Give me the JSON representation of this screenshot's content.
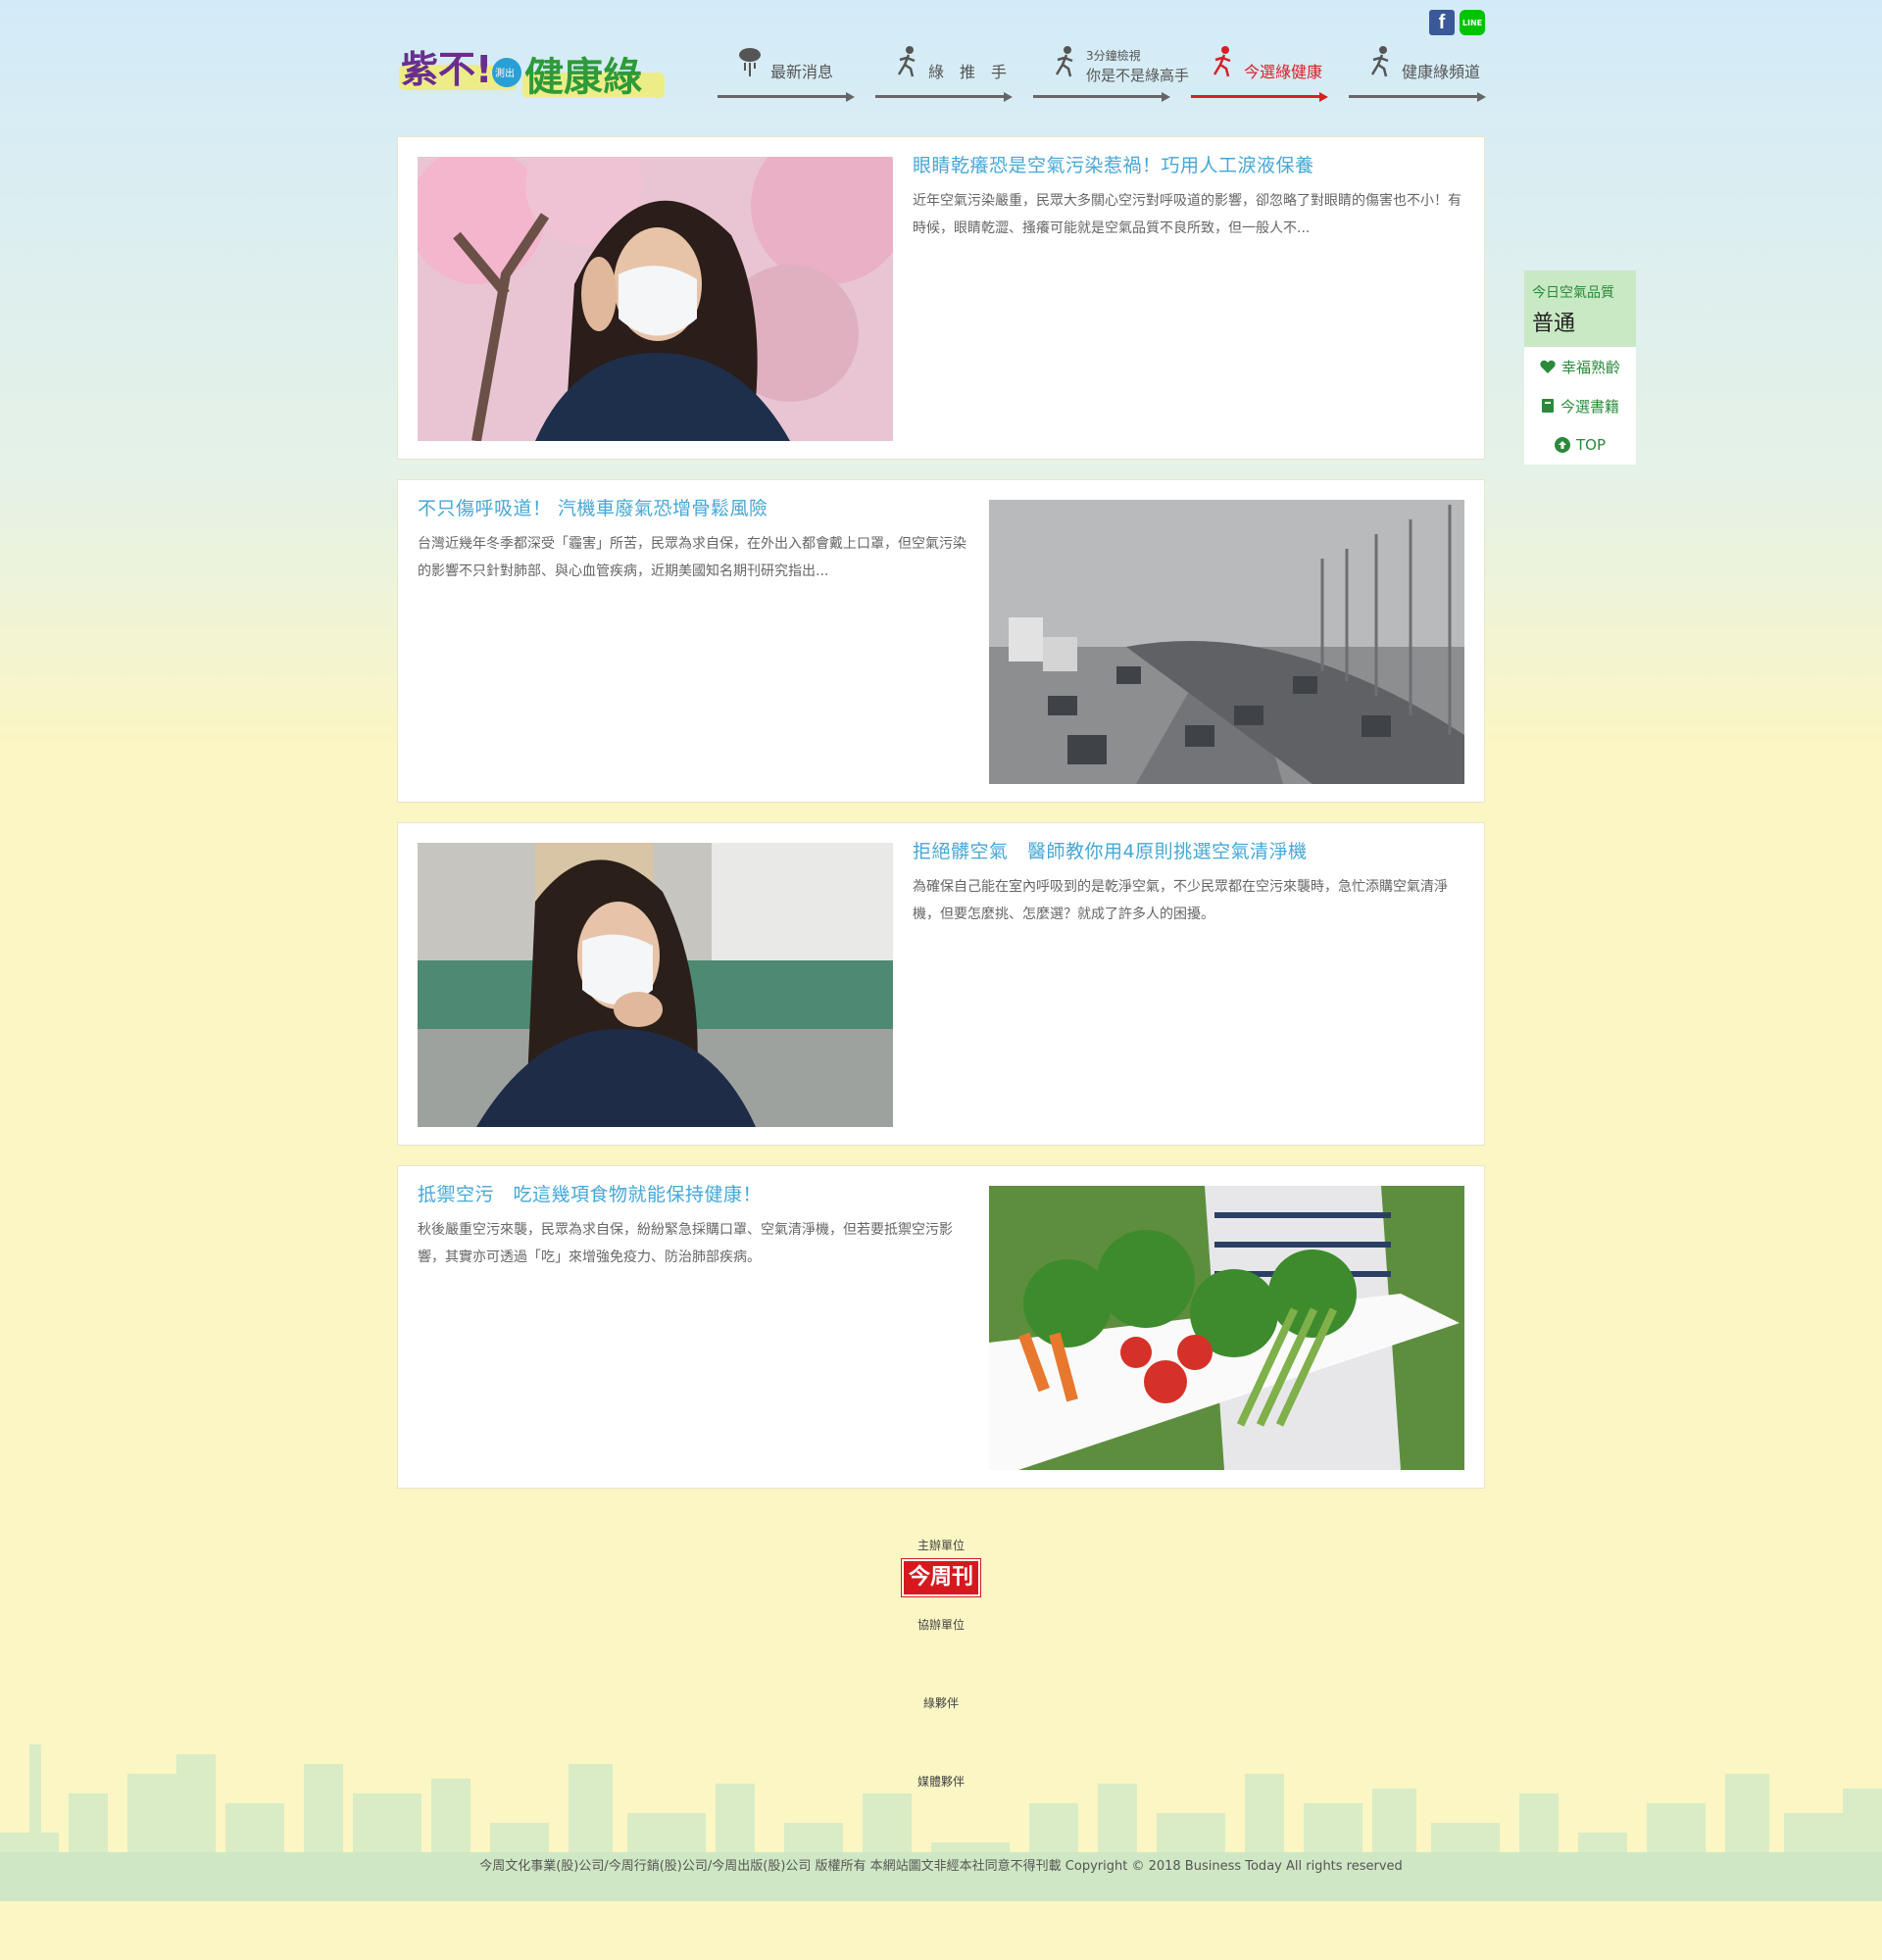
{
  "header": {
    "logo_title": "紫不!",
    "logo_small": "測出",
    "logo_main": "健康綠",
    "social": {
      "facebook_icon": "facebook-icon",
      "line_label": "LINE"
    },
    "nav": [
      {
        "label": "最新消息",
        "icon": "cloud-rain-icon"
      },
      {
        "label": "綠　推　手",
        "icon": "runner-icon"
      },
      {
        "small": "3分鐘檢視",
        "label": "你是不是綠高手",
        "icon": "runner-icon"
      },
      {
        "label": "今選綠健康",
        "icon": "runner-red-icon",
        "active": true
      },
      {
        "label": "健康綠頻道",
        "icon": "runner-icon"
      }
    ]
  },
  "articles": [
    {
      "title": "眼睛乾癢恐是空氣污染惹禍！巧用人工淚液保養",
      "excerpt": "近年空氣污染嚴重，民眾大多關心空污對呼吸道的影響，卻忽略了對眼睛的傷害也不小！有時候，眼睛乾澀、搔癢可能就是空氣品質不良所致，但一般人不...",
      "image": "woman-mask-cherry-blossom"
    },
    {
      "title": "不只傷呼吸道！ 汽機車廢氣恐增骨鬆風險",
      "excerpt": "台灣近幾年冬季都深受「霾害」所苦，民眾為求自保，在外出入都會戴上口罩，但空氣污染的影響不只針對肺部、與心血管疾病，近期美國知名期刊研究指出...",
      "image": "smoggy-highway-traffic"
    },
    {
      "title": "拒絕髒空氣　醫師教你用4原則挑選空氣清淨機",
      "excerpt": "為確保自己能在室內呼吸到的是乾淨空氣，不少民眾都在空污來襲時，急忙添購空氣清淨機，但要怎麼挑、怎麼選？就成了許多人的困擾。",
      "image": "woman-mask-coughing"
    },
    {
      "title": "抵禦空污　吃這幾項食物就能保持健康！",
      "excerpt": "秋後嚴重空污來襲，民眾為求自保，紛紛緊急採購口罩、空氣清淨機，但若要抵禦空污影響，其實亦可透過「吃」來增強免疫力、防治肺部疾病。",
      "image": "vegetable-crate"
    }
  ],
  "sidebar": {
    "aq_title": "今日空氣品質",
    "aq_value": "普通",
    "links": [
      {
        "label": "幸福熟齡",
        "icon": "heart-icon"
      },
      {
        "label": "今選書籍",
        "icon": "book-icon"
      },
      {
        "label": "TOP",
        "icon": "arrow-up-circle-icon"
      }
    ]
  },
  "footer": {
    "organizer_label": "主辦單位",
    "organizer_logo": "今周刊",
    "co_organizer_label": "協辦單位",
    "partner_label": "綠夥伴",
    "media_label": "媒體夥伴",
    "copyright": "今周文化事業(股)公司/今周行銷(股)公司/今周出版(股)公司 版權所有 本網站圖文非經本社同意不得刊載 Copyright © 2018 Business Today All rights reserved"
  },
  "colors": {
    "accent_blue": "#46a7d6",
    "active_red": "#d71f26",
    "green": "#2a8a3a",
    "aq_bg": "#c9e8c4"
  }
}
